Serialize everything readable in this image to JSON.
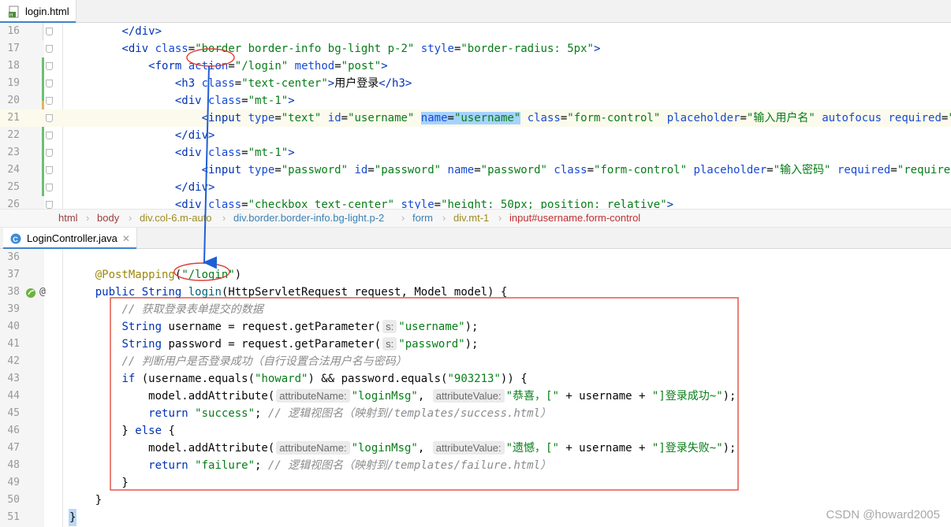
{
  "tabs": {
    "top": {
      "filename": "login.html",
      "icon": "html-file-icon"
    },
    "bottom": {
      "filename": "LoginController.java",
      "icon": "java-class-icon",
      "close": "✕"
    }
  },
  "html_lines": [
    {
      "n": "16",
      "t": "        </div>"
    },
    {
      "n": "17",
      "t": "        <div class=\"border border-info bg-light p-2\" style=\"border-radius: 5px\">"
    },
    {
      "n": "18",
      "t": "            <form action=\"/login\" method=\"post\">"
    },
    {
      "n": "19",
      "t": "                <h3 class=\"text-center\">用户登录</h3>"
    },
    {
      "n": "20",
      "t": "                <div class=\"mt-1\">"
    },
    {
      "n": "21",
      "t": "                    <input type=\"text\" id=\"username\" name=\"username\" class=\"form-control\" placeholder=\"输入用户名\" autofocus required=\"required\">"
    },
    {
      "n": "22",
      "t": "                </div>"
    },
    {
      "n": "23",
      "t": "                <div class=\"mt-1\">"
    },
    {
      "n": "24",
      "t": "                    <input type=\"password\" id=\"password\" name=\"password\" class=\"form-control\" placeholder=\"输入密码\" required=\"required\">"
    },
    {
      "n": "25",
      "t": "                </div>"
    },
    {
      "n": "26",
      "t": "                <div class=\"checkbox text-center\" style=\"height: 50px; position: relative\">"
    }
  ],
  "breadcrumb": [
    "html",
    "body",
    "div.col-6.m-auto",
    "div.border.border-info.bg-light.p-2",
    "form",
    "div.mt-1",
    "input#username.form-control"
  ],
  "java_lines": [
    {
      "n": "36",
      "t": ""
    },
    {
      "n": "37",
      "t": "    @PostMapping(\"/login\")"
    },
    {
      "n": "38",
      "t": "    public String login(HttpServletRequest request, Model model) {"
    },
    {
      "n": "39",
      "t": "        // 获取登录表单提交的数据"
    },
    {
      "n": "40",
      "t": "        String username = request.getParameter( s: \"username\");"
    },
    {
      "n": "41",
      "t": "        String password = request.getParameter( s: \"password\");"
    },
    {
      "n": "42",
      "t": "        // 判断用户是否登录成功（自行设置合法用户名与密码）"
    },
    {
      "n": "43",
      "t": "        if (username.equals(\"howard\") && password.equals(\"903213\")) {"
    },
    {
      "n": "44",
      "t": "            model.addAttribute( attributeName: \"loginMsg\",  attributeValue: \"恭喜，[\" + username + \"]登录成功~\");"
    },
    {
      "n": "45",
      "t": "            return \"success\"; // 逻辑视图名（映射到/templates/success.html）"
    },
    {
      "n": "46",
      "t": "        } else {"
    },
    {
      "n": "47",
      "t": "            model.addAttribute( attributeName: \"loginMsg\",  attributeValue: \"遗憾，[\" + username + \"]登录失败~\");"
    },
    {
      "n": "48",
      "t": "            return \"failure\"; // 逻辑视图名（映射到/templates/failure.html）"
    },
    {
      "n": "49",
      "t": "        }"
    },
    {
      "n": "50",
      "t": "    }"
    },
    {
      "n": "51",
      "t": "}"
    }
  ],
  "gutter_icons": {
    "line": "38",
    "bean": "spring-bean-icon",
    "annotation": "@"
  },
  "annotations": {
    "arrow_color": "#1f5fd6",
    "circle_color": "#e03c31",
    "box_color": "#e03c31"
  },
  "watermark": "CSDN @howard2005"
}
